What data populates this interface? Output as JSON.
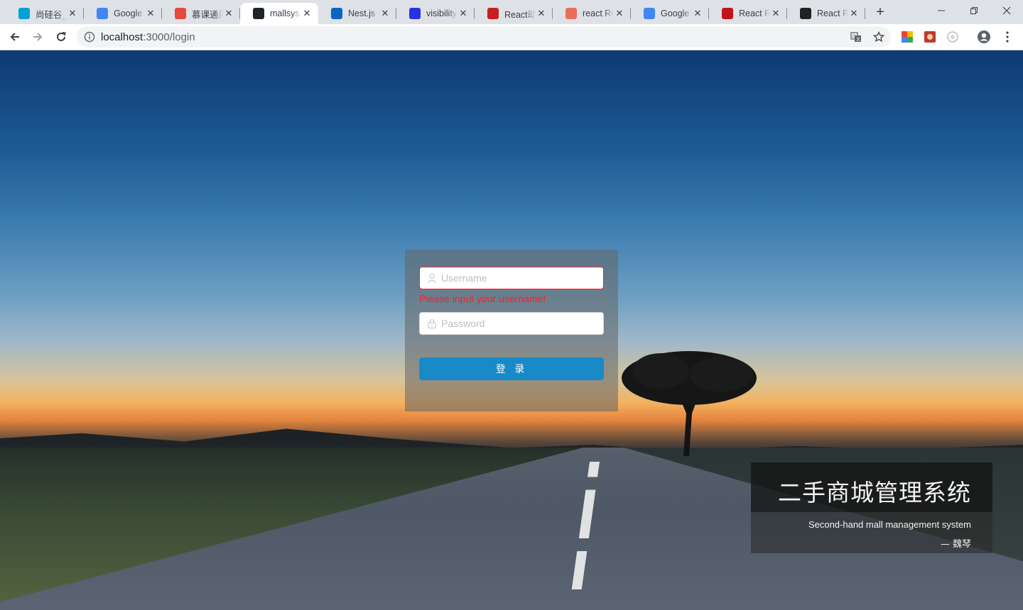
{
  "browser": {
    "tabs": [
      {
        "title": "尚硅谷_",
        "icon": "bilibili-icon",
        "color": "#00a1d6",
        "active": false
      },
      {
        "title": "Google",
        "icon": "google-translate-icon",
        "color": "#4285f4",
        "active": false
      },
      {
        "title": "慕课通用",
        "icon": "imooc-icon",
        "color": "#e64a3a",
        "active": false
      },
      {
        "title": "mallsys",
        "icon": "react-icon",
        "color": "#20232a",
        "active": true
      },
      {
        "title": "Nest.js",
        "icon": "nestjs-icon",
        "color": "#0a66c2",
        "active": false
      },
      {
        "title": "visibility",
        "icon": "baidu-icon",
        "color": "#2932e1",
        "active": false
      },
      {
        "title": "React动",
        "icon": "csdn-icon",
        "color": "#c81e1e",
        "active": false
      },
      {
        "title": "react Re",
        "icon": "jianshu-icon",
        "color": "#ea6f5a",
        "active": false
      },
      {
        "title": "Google",
        "icon": "google-translate-icon",
        "color": "#4285f4",
        "active": false
      },
      {
        "title": "React R",
        "icon": "dots-icon",
        "color": "#c0151b",
        "active": false
      },
      {
        "title": "React R",
        "icon": "box-icon",
        "color": "#202124",
        "active": false
      }
    ],
    "url_host": "localhost",
    "url_path": ":3000/login"
  },
  "login": {
    "username_placeholder": "Username",
    "password_placeholder": "Password",
    "error_message": "Please input your username!",
    "submit_label": "登 录"
  },
  "title_card": {
    "title": "二手商城管理系统",
    "subtitle": "Second-hand mall management system",
    "author": "— 魏琴"
  },
  "colors": {
    "primary_button": "#188ac8",
    "error": "#f5222d"
  }
}
